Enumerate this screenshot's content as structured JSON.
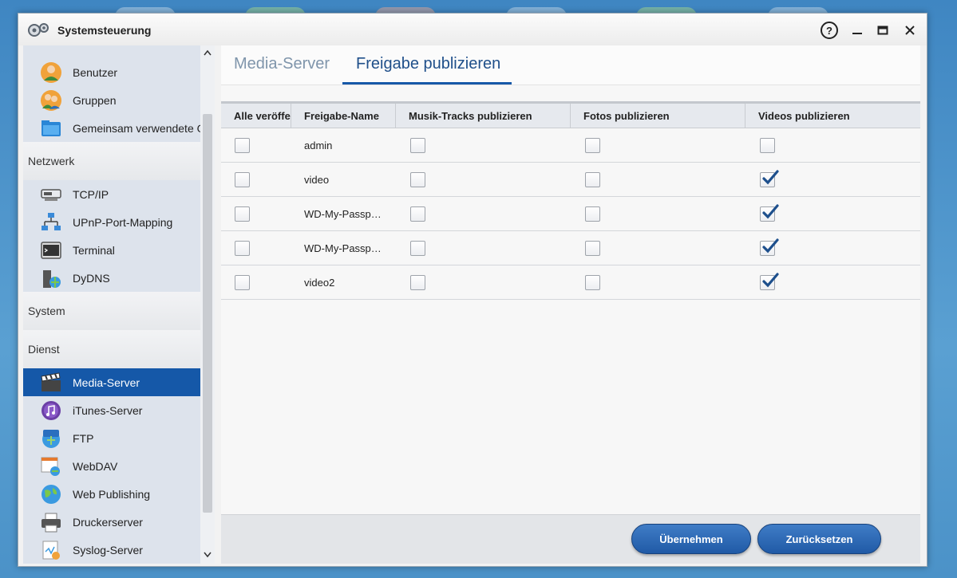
{
  "window": {
    "title": "Systemsteuerung",
    "help_glyph": "?"
  },
  "sidebar": {
    "items_top": [
      {
        "label": "Benutzer",
        "icon": "user-icon"
      },
      {
        "label": "Gruppen",
        "icon": "group-icon"
      },
      {
        "label": "Gemeinsam verwendete O",
        "icon": "shared-folder-icon"
      }
    ],
    "categories": {
      "network": "Netzwerk",
      "system": "System",
      "service": "Dienst"
    },
    "items_network": [
      {
        "label": "TCP/IP",
        "icon": "network-card-icon"
      },
      {
        "label": "UPnP-Port-Mapping",
        "icon": "network-tree-icon"
      },
      {
        "label": "Terminal",
        "icon": "terminal-icon"
      },
      {
        "label": "DyDNS",
        "icon": "dns-icon"
      }
    ],
    "items_service": [
      {
        "label": "Media-Server",
        "icon": "clapperboard-icon",
        "active": true
      },
      {
        "label": "iTunes-Server",
        "icon": "music-note-icon"
      },
      {
        "label": "FTP",
        "icon": "ftp-icon"
      },
      {
        "label": "WebDAV",
        "icon": "webdav-icon"
      },
      {
        "label": "Web Publishing",
        "icon": "globe-icon"
      },
      {
        "label": "Druckerserver",
        "icon": "printer-icon"
      },
      {
        "label": "Syslog-Server",
        "icon": "syslog-icon"
      }
    ]
  },
  "tabs": [
    {
      "label": "Media-Server",
      "active": false
    },
    {
      "label": "Freigabe publizieren",
      "active": true
    }
  ],
  "table": {
    "columns": [
      "Alle veröffen",
      "Freigabe-Name",
      "Musik-Tracks publizieren",
      "Fotos publizieren",
      "Videos publizieren"
    ],
    "rows": [
      {
        "all": false,
        "name": "admin",
        "music": false,
        "photos": false,
        "videos": false
      },
      {
        "all": false,
        "name": "video",
        "music": false,
        "photos": false,
        "videos": true
      },
      {
        "all": false,
        "name": "WD-My-Passp…",
        "music": false,
        "photos": false,
        "videos": true
      },
      {
        "all": false,
        "name": "WD-My-Passp…",
        "music": false,
        "photos": false,
        "videos": true
      },
      {
        "all": false,
        "name": "video2",
        "music": false,
        "photos": false,
        "videos": true
      }
    ]
  },
  "buttons": {
    "apply": "Übernehmen",
    "reset": "Zurücksetzen"
  },
  "colors": {
    "accent": "#1558a8",
    "checkmark": "#1d4f8c"
  }
}
